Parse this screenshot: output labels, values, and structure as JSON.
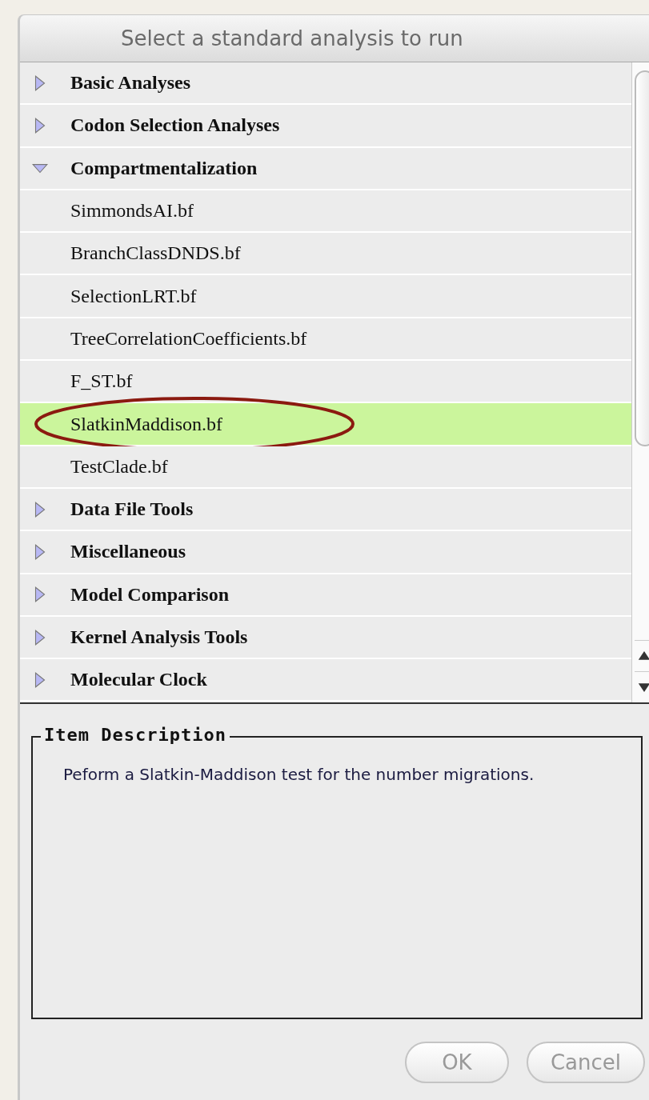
{
  "window": {
    "title": "Select a standard analysis to run"
  },
  "tree": [
    {
      "label": "Basic Analyses",
      "expanded": false,
      "selected": false
    },
    {
      "label": "Codon Selection Analyses",
      "expanded": false,
      "selected": false
    },
    {
      "label": "Compartmentalization",
      "expanded": true,
      "selected": false,
      "children": [
        {
          "label": "SimmondsAI.bf",
          "selected": false
        },
        {
          "label": "BranchClassDNDS.bf",
          "selected": false
        },
        {
          "label": "SelectionLRT.bf",
          "selected": false
        },
        {
          "label": "TreeCorrelationCoefficients.bf",
          "selected": false
        },
        {
          "label": "F_ST.bf",
          "selected": false
        },
        {
          "label": "SlatkinMaddison.bf",
          "selected": true
        },
        {
          "label": "TestClade.bf",
          "selected": false
        }
      ]
    },
    {
      "label": "Data File Tools",
      "expanded": false,
      "selected": false
    },
    {
      "label": "Miscellaneous",
      "expanded": false,
      "selected": false
    },
    {
      "label": "Model Comparison",
      "expanded": false,
      "selected": false
    },
    {
      "label": "Kernel Analysis Tools",
      "expanded": false,
      "selected": false
    },
    {
      "label": "Molecular Clock",
      "expanded": false,
      "selected": false
    }
  ],
  "description": {
    "title": "Item Description",
    "text": "Peform a Slatkin-Maddison test for the number migrations."
  },
  "buttons": [
    {
      "label": "OK",
      "disabled": true
    },
    {
      "label": "Cancel",
      "disabled": true
    }
  ]
}
